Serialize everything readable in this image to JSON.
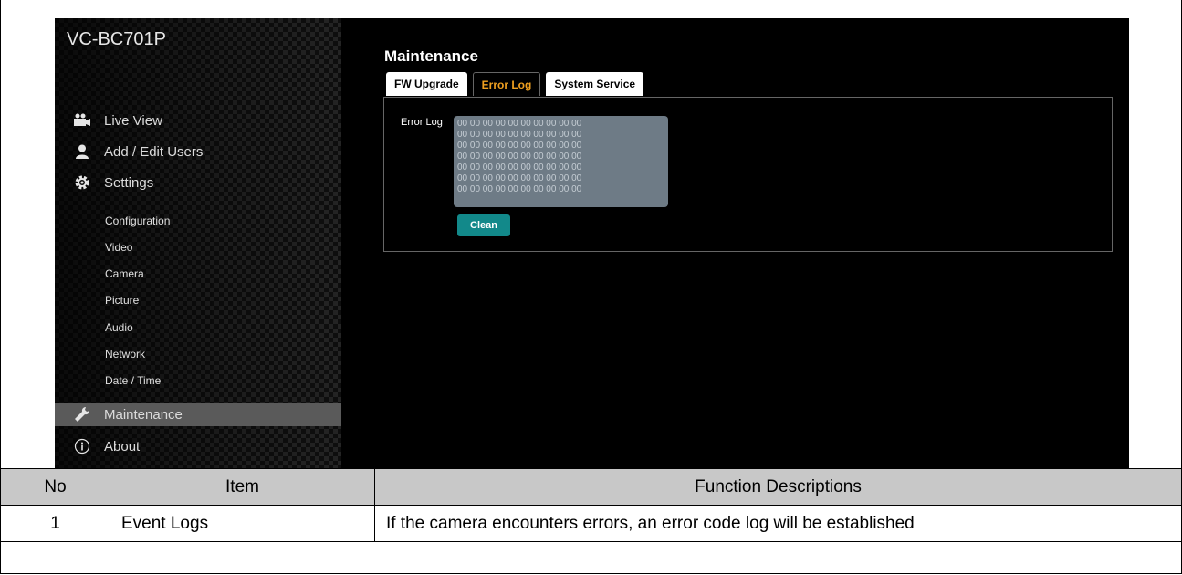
{
  "screenshot": {
    "model": "VC-BC701P",
    "nav": {
      "live_view": "Live View",
      "add_edit_users": "Add / Edit Users",
      "settings": "Settings",
      "sub": [
        "Configuration",
        "Video",
        "Camera",
        "Picture",
        "Audio",
        "Network",
        "Date / Time"
      ],
      "maintenance": "Maintenance",
      "about": "About"
    },
    "main": {
      "title": "Maintenance",
      "tabs": [
        "FW Upgrade",
        "Error Log",
        "System Service"
      ],
      "active_tab": "Error Log",
      "error_log_label": "Error Log",
      "error_log_value": "00 00 00 00 00 00 00 00 00 00\n00 00 00 00 00 00 00 00 00 00\n00 00 00 00 00 00 00 00 00 00\n00 00 00 00 00 00 00 00 00 00\n00 00 00 00 00 00 00 00 00 00\n00 00 00 00 00 00 00 00 00 00\n00 00 00 00 00 00 00 00 00 00",
      "clean_label": "Clean"
    },
    "colors": {
      "active_tab_text": "#f0a020",
      "clean_button": "#12898a",
      "active_nav_bg": "#5a5a5a"
    }
  },
  "table": {
    "headers": [
      "No",
      "Item",
      "Function Descriptions"
    ],
    "rows": [
      [
        "1",
        "Event Logs",
        "If the camera encounters errors, an error code log will be established"
      ]
    ]
  }
}
